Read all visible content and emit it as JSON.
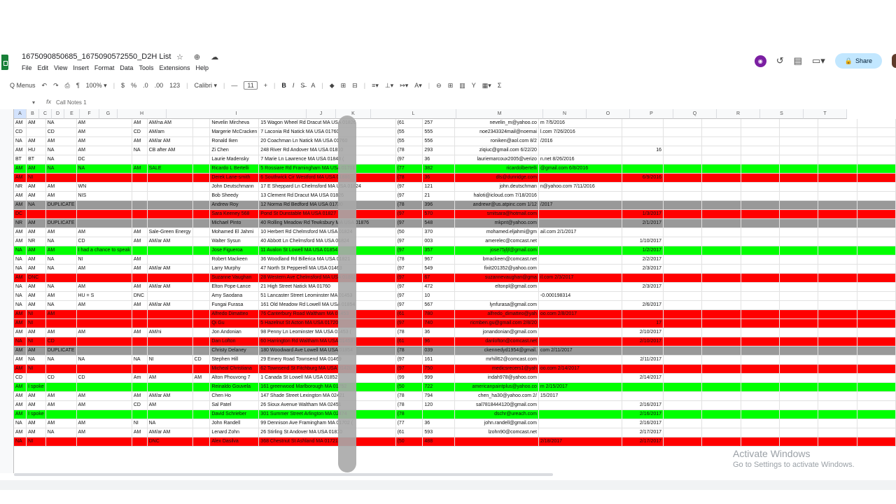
{
  "doc": {
    "title": "1675090850685_1675090572550_D2H List",
    "title_icons": "☆ ⊕ ☁",
    "menu": [
      "File",
      "Edit",
      "View",
      "Insert",
      "Format",
      "Data",
      "Tools",
      "Extensions",
      "Help"
    ]
  },
  "header": {
    "avatar": "◉",
    "history_icon": "↺",
    "comment_icon": "▤",
    "meet_icon": "▭▾",
    "share_label": "Share"
  },
  "toolbar": {
    "menus": "Q Menus",
    "undo": "↶",
    "redo": "↷",
    "print": "⎙",
    "paint": "¶",
    "zoom": "100% ▾",
    "dollar": "$",
    "percent": "%",
    "dec_down": ".0",
    "dec_up": ".00",
    "num_fmt": "123",
    "font": "Calibri ▾",
    "minus": "—",
    "font_size": "11",
    "plus": "+",
    "bold": "B",
    "italic": "I",
    "strike": "S̶",
    "text_color": "A",
    "fill": "◆",
    "borders": "⊞",
    "merge": "⊟",
    "halign": "≡▾",
    "valign": "⊥▾",
    "wrap": "↦▾",
    "rotate": "A▾",
    "link": "⊖",
    "comment": "⊞",
    "chart": "▥",
    "filter": "Y",
    "views": "▦▾",
    "func": "Σ"
  },
  "formula": {
    "namebox": "▾",
    "fx": "fx",
    "value": "Call Notes 1"
  },
  "columns": [
    "A",
    "B",
    "C",
    "D",
    "E",
    "F",
    "G",
    "H",
    "I",
    "J",
    "K",
    "L",
    "M",
    "N",
    "O",
    "P",
    "Q",
    "R",
    "S",
    "T"
  ],
  "rows": [
    {
      "style": "",
      "cells": [
        "AM",
        "AM",
        "NA",
        "AM",
        "AM",
        "AM/na AM",
        "",
        "Nevelin Mircheva",
        "15 Wagon Wheel Rd Dracut MA USA 01826",
        "(61",
        "257",
        "nevelin_m@yahoo.co",
        "m 7/5/2016",
        ""
      ]
    },
    {
      "style": "",
      "cells": [
        "CD",
        "",
        "CD",
        "AM",
        "CD",
        "AM/am",
        "",
        "Margerie McCracken",
        "7 Laconia Rd Natick MA USA 01760",
        "(55",
        "555",
        "noe2343324mail@noemai",
        "l.com 7/26/2016",
        ""
      ]
    },
    {
      "style": "",
      "cells": [
        "NA",
        "AM",
        "AM",
        "AM",
        "AM",
        "AM/ar AM",
        "",
        "Ronald Iken",
        "20 Coachman Ln Natick MA USA 01760",
        "(55",
        "556",
        "roniken@aol.com 8/2",
        "/2016",
        ""
      ]
    },
    {
      "style": "",
      "cells": [
        "AM",
        "HU",
        "NA",
        "AM",
        "NA",
        "CB after AM",
        "",
        "Zi Chen",
        "248 River Rd Andover MA USA 01810",
        "(78",
        "293",
        "ziqiuc@gmail.com 6/22/20",
        "",
        "16"
      ]
    },
    {
      "style": "",
      "cells": [
        "BT",
        "BT",
        "NA",
        "DC",
        "",
        "",
        "",
        "Laurie Madensky",
        "7 Marie Ln Lawrence MA USA 01843 (",
        "(97",
        "36",
        "lauriemarcoux2005@verizo",
        "n.net 8/26/2016",
        ""
      ]
    },
    {
      "style": "green",
      "cells": [
        "AM",
        "AM",
        "NA",
        "NA",
        "AM",
        "SALE",
        "",
        "Ricardo L Bertelli",
        "5 Rossiare Rd Framingham MA USA 01701",
        "(77",
        "382",
        "ricardolbertelli",
        "@gmail.com 6/8/2016",
        ""
      ]
    },
    {
      "style": "red",
      "cells": [
        "AM",
        "NI",
        "",
        "",
        "",
        "",
        "",
        "Derek Lane-smith",
        "6 Southwick Cir Westford MA USA 01886",
        "(78",
        "36",
        "dls@dunridge.com",
        "",
        "6/9/2016"
      ]
    },
    {
      "style": "",
      "cells": [
        "NR",
        "AM",
        "AM",
        "WN",
        "",
        "",
        "",
        "John Deutschmann",
        "17 E Sheppard Ln Chelmsford MA USA 01824",
        "(97",
        "121",
        "john.deutschman",
        "n@yahoo.com 7/11/2016",
        ""
      ]
    },
    {
      "style": "",
      "cells": [
        "AM",
        "AM",
        "AM",
        "NIS",
        "",
        "",
        "",
        "Bob Sheedy",
        "13 Clement Rd Dracut MA USA 01826",
        "(97",
        "21",
        "haloti@icloud.com 7/18/2016",
        "",
        ""
      ]
    },
    {
      "style": "gray",
      "cells": [
        "AM",
        "NA",
        "DUPLICATE",
        "",
        "",
        "",
        "",
        "Andrew Roy",
        "12 Norma Rd Bedford MA USA 01730",
        "(78",
        "396",
        "andrewr@us.atpinc.com 1/12",
        "/2017",
        ""
      ]
    },
    {
      "style": "red",
      "cells": [
        "DC",
        "",
        "",
        "",
        "",
        "",
        "",
        "Sara Keeney 568",
        "Pond St Dunstable MA USA 01827",
        "(97",
        "570",
        "smitsara@hotmail.com",
        "",
        "1/3/2017"
      ]
    },
    {
      "style": "gray",
      "cells": [
        "NR",
        "AM",
        "DUPLICATE",
        "",
        "",
        "",
        "",
        "Michael Pinto",
        "40 Rolling Meadow Rd Tewksbury MA USA 01876",
        "(97",
        "548",
        "mkpnt@yahoo.com",
        "",
        "2/1/2017"
      ]
    },
    {
      "style": "",
      "cells": [
        "AM",
        "AM",
        "AM",
        "AM",
        "AM",
        "Sale-Green Energy",
        "",
        "Mohamed El Jahmi",
        "10 Herbert Rd Chelmsford MA USA 01824",
        "(50",
        "370",
        "mohamed.eljahmi@gm",
        "ail.com 2/1/2017",
        ""
      ]
    },
    {
      "style": "",
      "cells": [
        "AM",
        "NR",
        "NA",
        "CD",
        "AM",
        "AM/ar AM",
        "",
        "Walter Sysun",
        "40 Abbott Ln Chelmsford MA USA 01824",
        "(97",
        "003",
        "amerelec@comcast.net",
        "",
        "1/10/2017"
      ]
    },
    {
      "style": "green",
      "cells": [
        "NA",
        "AM",
        "AM",
        "I had a chance to speak",
        "",
        "",
        "",
        "Jose Figueroa",
        "11 Avalon St Lowell MA USA 01854",
        "(97",
        "357",
        "jose75jfjf@gmail.com",
        "",
        "1/2/2017"
      ]
    },
    {
      "style": "",
      "cells": [
        "NA",
        "AM",
        "NA",
        "NI",
        "AM",
        "",
        "",
        "Robert Mackeen",
        "36 Woodland Rd Billerica MA USA 01821",
        "(78",
        "967",
        "bmackeen@comcast.net",
        "",
        "2/2/2017"
      ]
    },
    {
      "style": "",
      "cells": [
        "NA",
        "AM",
        "NA",
        "AM",
        "AM",
        "AM/ar AM",
        "",
        "Larry Murphy",
        "47 North St Pepperell MA USA 01463",
        "(97",
        "549",
        "fixit201352@yahoo.com",
        "",
        "2/3/2017"
      ]
    },
    {
      "style": "red",
      "cells": [
        "AM",
        "DNC",
        "",
        "",
        "",
        "",
        "",
        "Suzanne Vaughan",
        "28 Western Ave Chelmsford MA USA 01863",
        "(97",
        "67",
        "suzannevaughan@gma",
        "il.com 2/3/2017",
        ""
      ]
    },
    {
      "style": "",
      "cells": [
        "NA",
        "AM",
        "NA",
        "AM",
        "AM",
        "AM/ar AM",
        "",
        "Elton Pope-Lance",
        "21 High Street Natick MA 01760",
        "(97",
        "472",
        "eltonpl@gmail.com",
        "",
        "2/3/2017"
      ]
    },
    {
      "style": "",
      "cells": [
        "NA",
        "AM",
        "AM",
        "HU = S",
        "DNC",
        "",
        "",
        "Amy Saodana",
        "51 Lancaster Street Leominster MA 01453",
        "(97",
        "10",
        "",
        "-0.000198314",
        ""
      ]
    },
    {
      "style": "",
      "cells": [
        "NA",
        "AM",
        "NA",
        "AM",
        "AM",
        "AM/ar AM",
        "",
        "Fungai Furasa",
        "161 Old Meadow Rd Lowell MA USA 01854",
        "(97",
        "567",
        "lynfurasa@gmail.com",
        "",
        "2/6/2017"
      ]
    },
    {
      "style": "red",
      "cells": [
        "AM",
        "NI",
        "AM",
        "",
        "",
        "",
        "",
        "Alfredo Dimatteo",
        "76 Canterbury Road Waltham MA 01453",
        "(61",
        "780",
        "alfredo_dimatteo@yah",
        "oo.com 2/8/2017",
        ""
      ]
    },
    {
      "style": "red",
      "cells": [
        "AM",
        "NI",
        "",
        "",
        "",
        "",
        "",
        "Qi Gu",
        "5 Hazelnut St Acton MA USA 01720",
        "(97",
        "740",
        "ricmben.gu@gmail.com 2/8/20",
        "",
        "17"
      ]
    },
    {
      "style": "",
      "cells": [
        "AM",
        "AM",
        "AM",
        "AM",
        "AM",
        "AM/ni",
        "",
        "Jon Andonian",
        "98 Penny Ln Leominster MA USA 01453 (",
        "(78",
        "36",
        "jonandonian@gmail.com",
        "",
        "2/10/2017"
      ]
    },
    {
      "style": "red",
      "cells": [
        "NA",
        "NI",
        "CD",
        "",
        "",
        "",
        "",
        "Dan Lofton",
        "60 Harrington Rd Waltham MA USA 01453 (",
        "(61",
        "96",
        "danlofton@comcast.net",
        "",
        "2/10/2017"
      ]
    },
    {
      "style": "gray",
      "cells": [
        "AM",
        "AM",
        "DUPLICATE",
        "",
        "",
        "",
        "",
        "Christy Delaney",
        "180 Woodward Ave Lowell MA USA 01854",
        "(78",
        "039",
        "ckennedyd1954@gmail.",
        "com 2/11/2017",
        ""
      ]
    },
    {
      "style": "",
      "cells": [
        "AM",
        "NA",
        "NA",
        "NA",
        "NA",
        "NI",
        "CD",
        "Stephen Hill",
        "29 Emery Road Townsend MA 01469",
        "(97",
        "161",
        "mrhill62@comcast.com",
        "",
        "2/11/2017"
      ]
    },
    {
      "style": "red",
      "cells": [
        "AM",
        "NI",
        "",
        "",
        "",
        "",
        "",
        "Micheal Christiana",
        "62 Townsend St Fitchburg MA USA 01420",
        "(97",
        "750",
        "medicsrecers1@yah",
        "oo.com 2/14/2017",
        ""
      ]
    },
    {
      "style": "",
      "cells": [
        "CD",
        "",
        "CD",
        "CD",
        "Am",
        "AM",
        "AM",
        "Alton Phouvong 7",
        "1 Canada St Lowell MA USA 01852",
        "(99",
        "999",
        "indah978@yahoo.com",
        "",
        "2/14/2017"
      ]
    },
    {
      "style": "green",
      "cells": [
        "AM",
        "I spoke",
        "",
        "",
        "",
        "",
        "",
        "Reinaldo Gouvela",
        "161 greenwood  Marlborough MA 01752",
        "(50",
        "722",
        "americanpaintplus@yahoo.co",
        "m 2/15/2017",
        ""
      ]
    },
    {
      "style": "",
      "cells": [
        "AM",
        "AM",
        "AM",
        "AM",
        "AM",
        "AM/ar AM",
        "",
        "Chen Ho",
        "147 Shade Street Lexington MA 02421",
        "(78",
        "794",
        "chen_ha30@yahoo.com 2/",
        "15/2017",
        ""
      ]
    },
    {
      "style": "",
      "cells": [
        "AM",
        "AM",
        "AM",
        "AM",
        "CD",
        "AM",
        "",
        "Sal Patel",
        "26 Sioux Avenue Waltham MA 02451",
        "(78",
        "120",
        "sal7818444120@gmail.com",
        "",
        "2/16/2017"
      ]
    },
    {
      "style": "green",
      "cells": [
        "AM",
        "I spoke",
        "",
        "",
        "",
        "",
        "",
        "David Schrieber",
        "301 Summer Street Arlington MA 02474",
        "(78",
        "",
        "dschr@ureach.com",
        "",
        "2/16/2017"
      ]
    },
    {
      "style": "",
      "cells": [
        "NA",
        "AM",
        "AM",
        "AM",
        "NI",
        "NA",
        "",
        "John Randell",
        "99 Dennison Ave Framingham MA 01702 (",
        "(77",
        "36",
        "john.randell@gmail.com",
        "",
        "2/16/2017"
      ]
    },
    {
      "style": "",
      "cells": [
        "AM",
        "AM",
        "NA",
        "AM",
        "AM",
        "AM/ar AM",
        "",
        "Lenard Zohn",
        "26 Stirling St Andover MA USA 01810",
        "(61",
        "593",
        "lzohn90@comcast.net",
        "",
        "2/17/2017"
      ]
    },
    {
      "style": "red",
      "cells": [
        "NA",
        "NI",
        "",
        "",
        "",
        "DNC",
        "",
        "Alex Dasilva",
        "368 Chestnut St Ashland MA 01721",
        "(50",
        "488",
        "",
        "2/18/2017",
        "2/17/2017"
      ]
    }
  ],
  "watermark": {
    "line1": "Activate Windows",
    "line2": "Go to Settings to activate Windows."
  }
}
